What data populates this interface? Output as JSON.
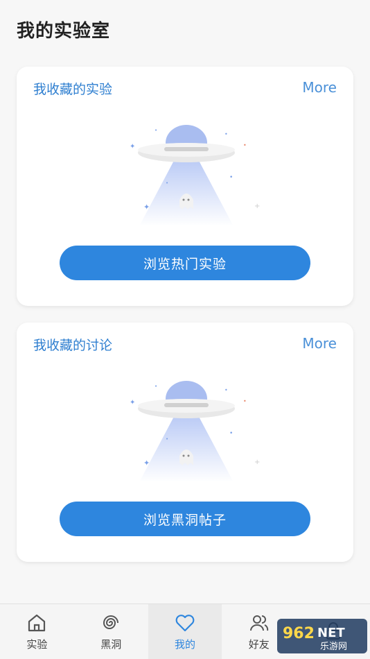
{
  "page_title": "我的实验室",
  "cards": [
    {
      "title": "我收藏的实验",
      "more": "More",
      "button": "浏览热门实验"
    },
    {
      "title": "我收藏的讨论",
      "more": "More",
      "button": "浏览黑洞帖子"
    }
  ],
  "tabs": [
    {
      "label": "实验",
      "icon": "home-icon"
    },
    {
      "label": "黑洞",
      "icon": "spiral-icon"
    },
    {
      "label": "我的",
      "icon": "heart-icon"
    },
    {
      "label": "好友",
      "icon": "friends-icon"
    },
    {
      "label": "",
      "icon": "lock-icon"
    }
  ],
  "watermark": {
    "brand": "962",
    "suffix": "NET",
    "sub": "乐游网"
  },
  "colors": {
    "accent": "#2e86de",
    "title_blue": "#2f7fd0"
  }
}
